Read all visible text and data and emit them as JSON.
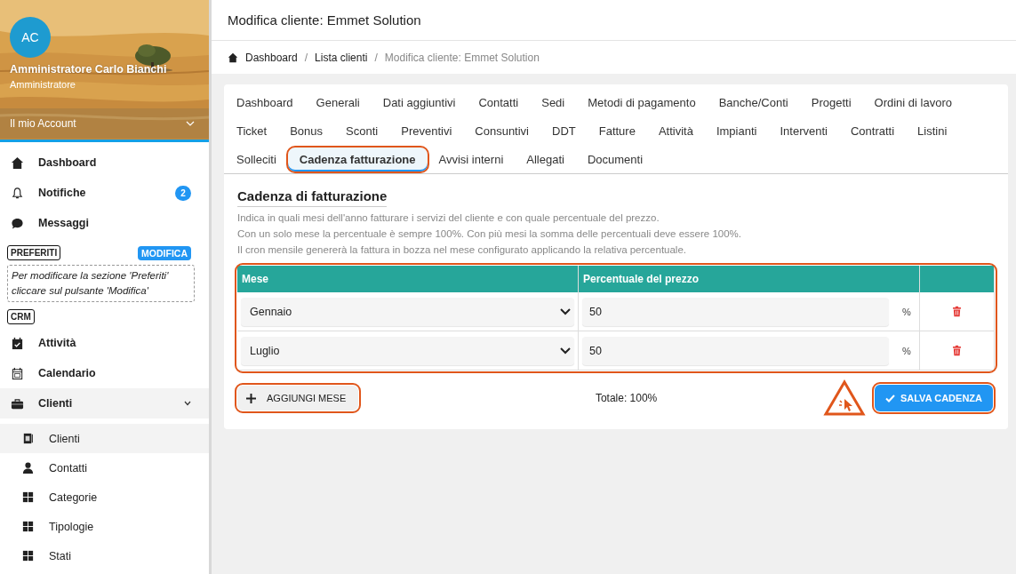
{
  "sidebar": {
    "user": {
      "initials": "AC",
      "name": "Amministratore Carlo Bianchi",
      "role": "Amministratore"
    },
    "account_menu": {
      "label": "Il mio Account",
      "expanded": false
    },
    "main_nav": [
      {
        "label": "Dashboard"
      },
      {
        "label": "Notifiche",
        "badge": "2"
      },
      {
        "label": "Messaggi"
      }
    ],
    "favorites": {
      "label": "PREFERITI",
      "button": "MODIFICA",
      "note": "Per modificare la sezione 'Preferiti' cliccare sul pulsante 'Modifica'"
    },
    "crm_label": "CRM",
    "crm_nav": [
      {
        "label": "Attività",
        "selected": false
      },
      {
        "label": "Calendario",
        "selected": false
      },
      {
        "label": "Clienti",
        "expanded": true,
        "selected": true,
        "children": [
          {
            "label": "Clienti",
            "selected": true
          },
          {
            "label": "Contatti",
            "selected": false
          },
          {
            "label": "Categorie",
            "selected": false
          },
          {
            "label": "Tipologie",
            "selected": false
          },
          {
            "label": "Stati",
            "selected": false
          }
        ]
      }
    ]
  },
  "page_title": "Modifica cliente: Emmet Solution",
  "breadcrumb_separator": "/",
  "breadcrumb": [
    {
      "label": "Dashboard",
      "current": false
    },
    {
      "label": "Lista clienti",
      "current": false
    },
    {
      "label": "Modifica cliente: Emmet Solution",
      "current": true
    }
  ],
  "tab_rows": [
    [
      {
        "label": "Dashboard",
        "selected": false
      },
      {
        "label": "Generali",
        "selected": false
      },
      {
        "label": "Dati aggiuntivi",
        "selected": false
      },
      {
        "label": "Contatti",
        "selected": false
      },
      {
        "label": "Sedi",
        "selected": false
      },
      {
        "label": "Metodi di pagamento",
        "selected": false
      },
      {
        "label": "Banche/Conti",
        "selected": false
      },
      {
        "label": "Progetti",
        "selected": false
      },
      {
        "label": "Ordini di lavoro",
        "selected": false
      }
    ],
    [
      {
        "label": "Ticket",
        "selected": false
      },
      {
        "label": "Bonus",
        "selected": false
      },
      {
        "label": "Sconti",
        "selected": false
      },
      {
        "label": "Preventivi",
        "selected": false
      },
      {
        "label": "Consuntivi",
        "selected": false
      },
      {
        "label": "DDT",
        "selected": false
      },
      {
        "label": "Fatture",
        "selected": false
      },
      {
        "label": "Attività",
        "selected": false
      },
      {
        "label": "Impianti",
        "selected": false
      },
      {
        "label": "Interventi",
        "selected": false
      },
      {
        "label": "Contratti",
        "selected": false
      },
      {
        "label": "Listini",
        "selected": false
      }
    ],
    [
      {
        "label": "Solleciti",
        "selected": false
      },
      {
        "label": "Cadenza fatturazione",
        "selected": true,
        "highlighted": true
      },
      {
        "label": "Avvisi interni",
        "selected": false
      },
      {
        "label": "Allegati",
        "selected": false
      },
      {
        "label": "Documenti",
        "selected": false
      }
    ]
  ],
  "section": {
    "heading": "Cadenza di fatturazione",
    "description": [
      "Indica in quali mesi dell'anno fatturare i servizi del cliente e con quale percentuale del prezzo.",
      "Con un solo mese la percentuale è sempre 100%. Con più mesi la somma delle percentuali deve essere 100%.",
      "Il cron mensile genererà la fattura in bozza nel mese configurato applicando la relativa percentuale."
    ],
    "table": {
      "highlighted": true,
      "columns": [
        "Mese",
        "Percentuale del prezzo"
      ],
      "rows": [
        {
          "month": "Gennaio",
          "percent": "50",
          "unit": "%"
        },
        {
          "month": "Luglio",
          "percent": "50",
          "unit": "%"
        }
      ]
    },
    "add_button": {
      "label": "AGGIUNGI MESE",
      "highlighted": true
    },
    "total": "Totale: 100%",
    "save_button": {
      "label": "SALVA CADENZA",
      "highlighted": true,
      "warning": true
    }
  }
}
